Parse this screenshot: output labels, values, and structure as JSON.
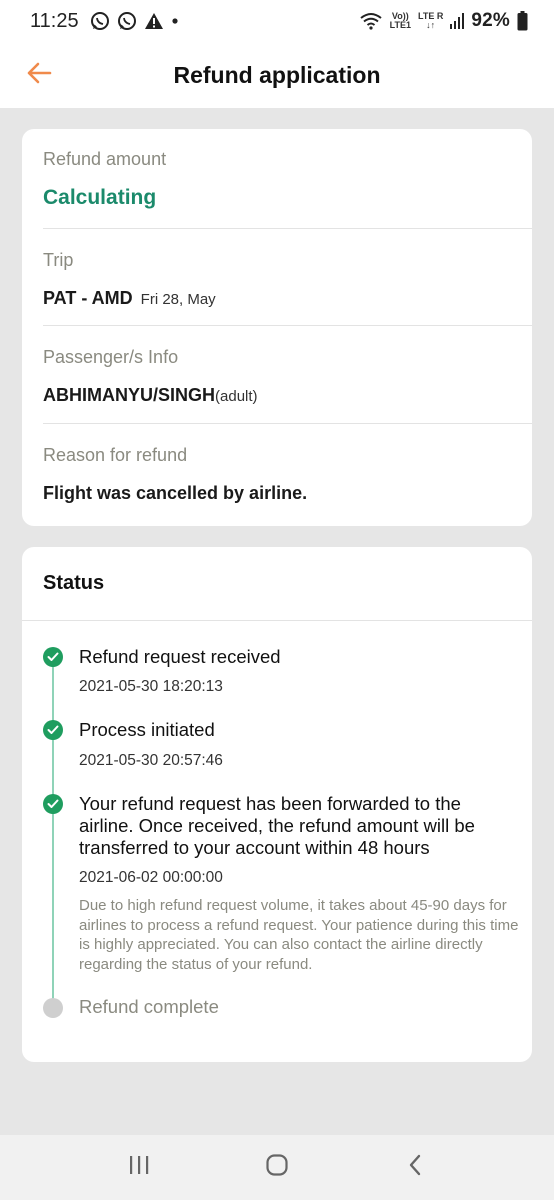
{
  "status_bar": {
    "time": "11:25",
    "volte_top": "Vo))",
    "volte_bottom": "LTE1",
    "lte_top": "LTE",
    "lte_roaming": "R",
    "battery": "92%"
  },
  "header": {
    "title": "Refund application",
    "back_icon": "arrow-left-icon",
    "accent": "#f08a4b"
  },
  "refund": {
    "amount_label": "Refund amount",
    "amount_value": "Calculating",
    "trip_label": "Trip",
    "trip_route": "PAT - AMD",
    "trip_date": "Fri 28, May",
    "passenger_label": "Passenger/s Info",
    "passenger_name": "ABHIMANYU/SINGH",
    "passenger_type": "(adult)",
    "reason_label": "Reason for refund",
    "reason_value": "Flight was cancelled by airline."
  },
  "status": {
    "heading": "Status",
    "steps": [
      {
        "title": "Refund request received",
        "time": "2021-05-30 18:20:13",
        "done": true
      },
      {
        "title": "Process initiated",
        "time": "2021-05-30 20:57:46",
        "done": true
      },
      {
        "title": "Your refund request has been forwarded to the airline. Once received, the refund amount will be transferred to your account within 48 hours",
        "time": "2021-06-02 00:00:00",
        "note": "Due to high refund request volume, it takes about 45-90 days for airlines to process a refund request. Your patience during this time is highly appreciated. You can also contact the airline directly regarding the status of your refund.",
        "done": true
      },
      {
        "title": "Refund complete",
        "done": false
      }
    ],
    "done_color": "#1f9d5f",
    "pending_color": "#cfcfcf"
  },
  "nav": {
    "recents_icon": "recents-icon",
    "home_icon": "home-icon",
    "back_icon": "back-chevron-icon"
  }
}
